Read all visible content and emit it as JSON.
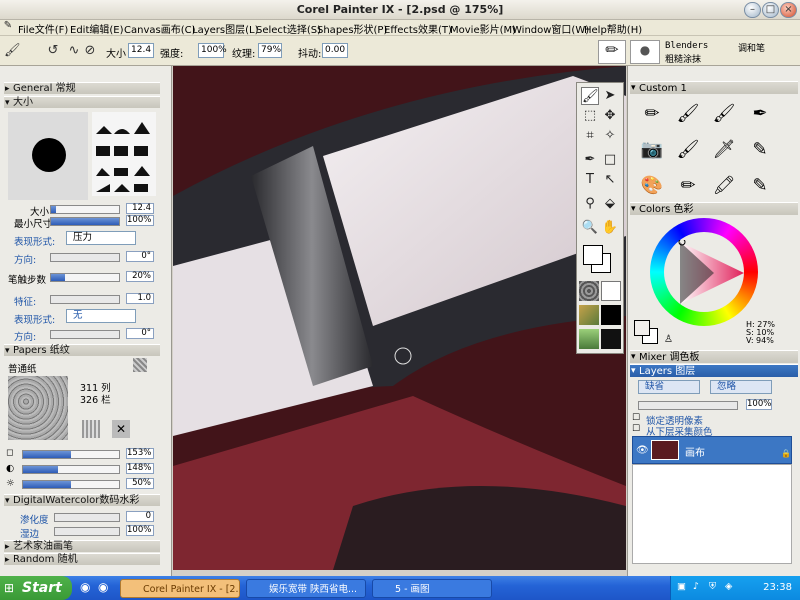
{
  "window": {
    "title": "Corel Painter IX - [2.psd @ 175%]"
  },
  "menu": [
    "File文件(F)",
    "Edit编辑(E)",
    "Canvas画布(C)",
    "Layers图层(L)",
    "Select选择(S)",
    "Shapes形状(P)",
    "Effects效果(T)",
    "Movie影片(M)",
    "Window窗口(W)",
    "Help帮助(H)"
  ],
  "toolbar": {
    "size_label": "大小",
    "size_value": "12.4",
    "strength_label": "强度:",
    "strength_value": "100%",
    "grain_label": "纹理:",
    "grain_value": "79%",
    "jitter_label": "抖动:",
    "jitter_value": "0.00",
    "blenders": "Blenders",
    "variant_cat": "调和笔",
    "variant": "粗糙涂抹"
  },
  "left": {
    "general": "General 常规",
    "size_section": "大小",
    "size_label": "大小",
    "size_value": "12.4",
    "min_size_label": "最小尺寸",
    "min_size_value": "100%",
    "expression_label": "表现形式:",
    "expression_value": "压力",
    "direction_label": "方向:",
    "direction_value": "0°",
    "stroke_label": "笔触步数",
    "stroke_value": "20%",
    "feature_label": "特征:",
    "feature_value": "1.0",
    "expression2_label": "表现形式:",
    "expression2_value": "无",
    "direction2_label": "方向:",
    "direction2_value": "0°",
    "papers": "Papers 纸纹",
    "paper_name": "普通纸",
    "paper_cols": "311 列",
    "paper_rows": "326 栏",
    "p1_value": "153%",
    "p2_value": "148%",
    "p3_value": "50%",
    "digital": "DigitalWatercolor数码水彩",
    "diffuse_label": "渗化度",
    "diffuse_value": "0",
    "wet_label": "湿边",
    "wet_value": "100%",
    "artist": "艺术家油画笔",
    "random": "Random 随机"
  },
  "right": {
    "custom": "Custom 1",
    "colors": "Colors 色彩",
    "hsv": {
      "h": "H: 27%",
      "s": "S: 10%",
      "v": "V: 94%"
    },
    "mixer": "Mixer 调色板",
    "layers": "Layers 图层",
    "composite_default": "缺省",
    "composite_ignore": "忽略",
    "opacity": "100%",
    "preserve": "锁定透明像素",
    "pick_under": "从下层采集颜色",
    "canvas_layer": "画布"
  },
  "taskbar": {
    "start": "Start",
    "tasks": [
      "Corel Painter IX - [2.p...",
      "娱乐宽带 陕西省电...",
      "5 - 画图"
    ],
    "clock": "23:38"
  },
  "colors": {
    "canvas_bg": "#421419",
    "selected_layer": "#3c77c4"
  }
}
